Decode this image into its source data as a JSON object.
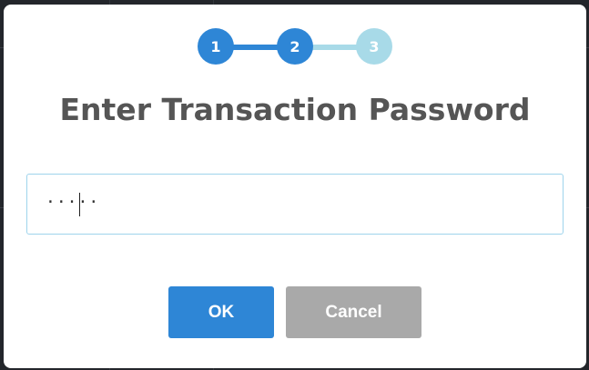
{
  "stepper": {
    "steps": [
      {
        "label": "1",
        "status": "complete",
        "color": "#2e86d6"
      },
      {
        "label": "2",
        "status": "active",
        "color": "#2e86d6"
      },
      {
        "label": "3",
        "status": "pending",
        "color": "#a8dae8"
      }
    ]
  },
  "dialog": {
    "title": "Enter Transaction Password"
  },
  "password": {
    "masked_value": "·····"
  },
  "buttons": {
    "ok_label": "OK",
    "cancel_label": "Cancel"
  },
  "colors": {
    "primary": "#2e86d6",
    "pending": "#a8dae8",
    "cancel": "#a9a9a9",
    "title": "#555555"
  }
}
